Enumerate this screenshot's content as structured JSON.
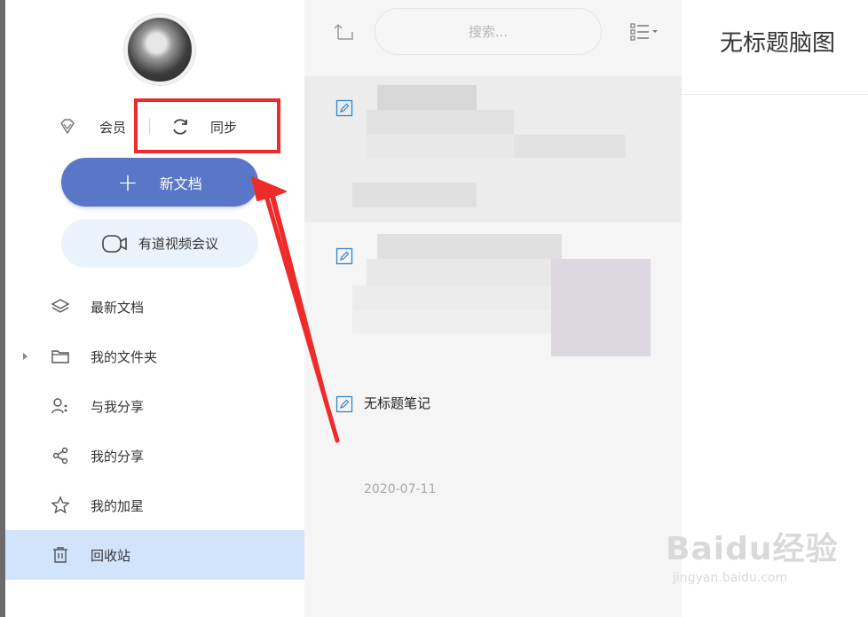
{
  "sidebar": {
    "member_label": "会员",
    "sync_label": "同步",
    "new_doc_label": "新文档",
    "video_meeting_label": "有道视频会议",
    "nav": [
      {
        "label": "最新文档",
        "icon": "layers-icon"
      },
      {
        "label": "我的文件夹",
        "icon": "folder-icon"
      },
      {
        "label": "与我分享",
        "icon": "shared-with-me-icon"
      },
      {
        "label": "我的分享",
        "icon": "share-icon"
      },
      {
        "label": "我的加星",
        "icon": "star-icon"
      },
      {
        "label": "回收站",
        "icon": "trash-icon"
      }
    ],
    "active_item": "回收站"
  },
  "list": {
    "search_placeholder": "搜索...",
    "items": [
      {
        "title": "无标题笔记",
        "date": "2020-07-11"
      }
    ]
  },
  "editor": {
    "title": "无标题脑图"
  },
  "watermark": {
    "brand": "Baidu经验",
    "url": "jingyan.baidu.com"
  },
  "colors": {
    "accent": "#5977c6",
    "highlight": "#ee2b2b",
    "active_bg": "#d2e4fc",
    "meeting_bg": "#eaf3fb"
  }
}
